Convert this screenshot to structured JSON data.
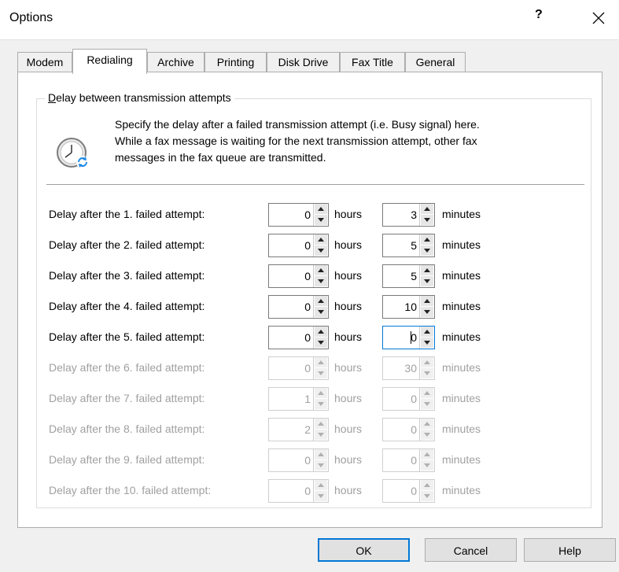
{
  "window": {
    "title": "Options",
    "help_label": "?"
  },
  "tabs": [
    {
      "label": "Modem"
    },
    {
      "label": "Redialing"
    },
    {
      "label": "Archive"
    },
    {
      "label": "Printing"
    },
    {
      "label": "Disk Drive"
    },
    {
      "label": "Fax Title"
    },
    {
      "label": "General"
    }
  ],
  "group": {
    "legend_first": "D",
    "legend_rest": "elay between transmission attempts",
    "desc_line1": "Specify the delay after a failed transmission attempt (i.e. Busy signal) here.",
    "desc_line2": "While a fax message is waiting for the next transmission attempt, other fax",
    "desc_line3": "messages in the fax queue are transmitted.",
    "icon": "clock-refresh-icon"
  },
  "units": {
    "hours": "hours",
    "minutes": "minutes"
  },
  "rows": [
    {
      "label": "Delay after the 1. failed attempt:",
      "hours": "0",
      "minutes": "3"
    },
    {
      "label": "Delay after the 2. failed attempt:",
      "hours": "0",
      "minutes": "5"
    },
    {
      "label": "Delay after the 3. failed attempt:",
      "hours": "0",
      "minutes": "5"
    },
    {
      "label": "Delay after the 4. failed attempt:",
      "hours": "0",
      "minutes": "10"
    },
    {
      "label": "Delay after the 5. failed attempt:",
      "hours": "0",
      "minutes": "0"
    },
    {
      "label": "Delay after the 6. failed attempt:",
      "hours": "0",
      "minutes": "30"
    },
    {
      "label": "Delay after the 7. failed attempt:",
      "hours": "1",
      "minutes": "0"
    },
    {
      "label": "Delay after the 8. failed attempt:",
      "hours": "2",
      "minutes": "0"
    },
    {
      "label": "Delay after the 9. failed attempt:",
      "hours": "0",
      "minutes": "0"
    },
    {
      "label": "Delay after the 10. failed attempt:",
      "hours": "0",
      "minutes": "0"
    }
  ],
  "buttons": {
    "ok": "OK",
    "cancel": "Cancel",
    "help": "Help"
  }
}
